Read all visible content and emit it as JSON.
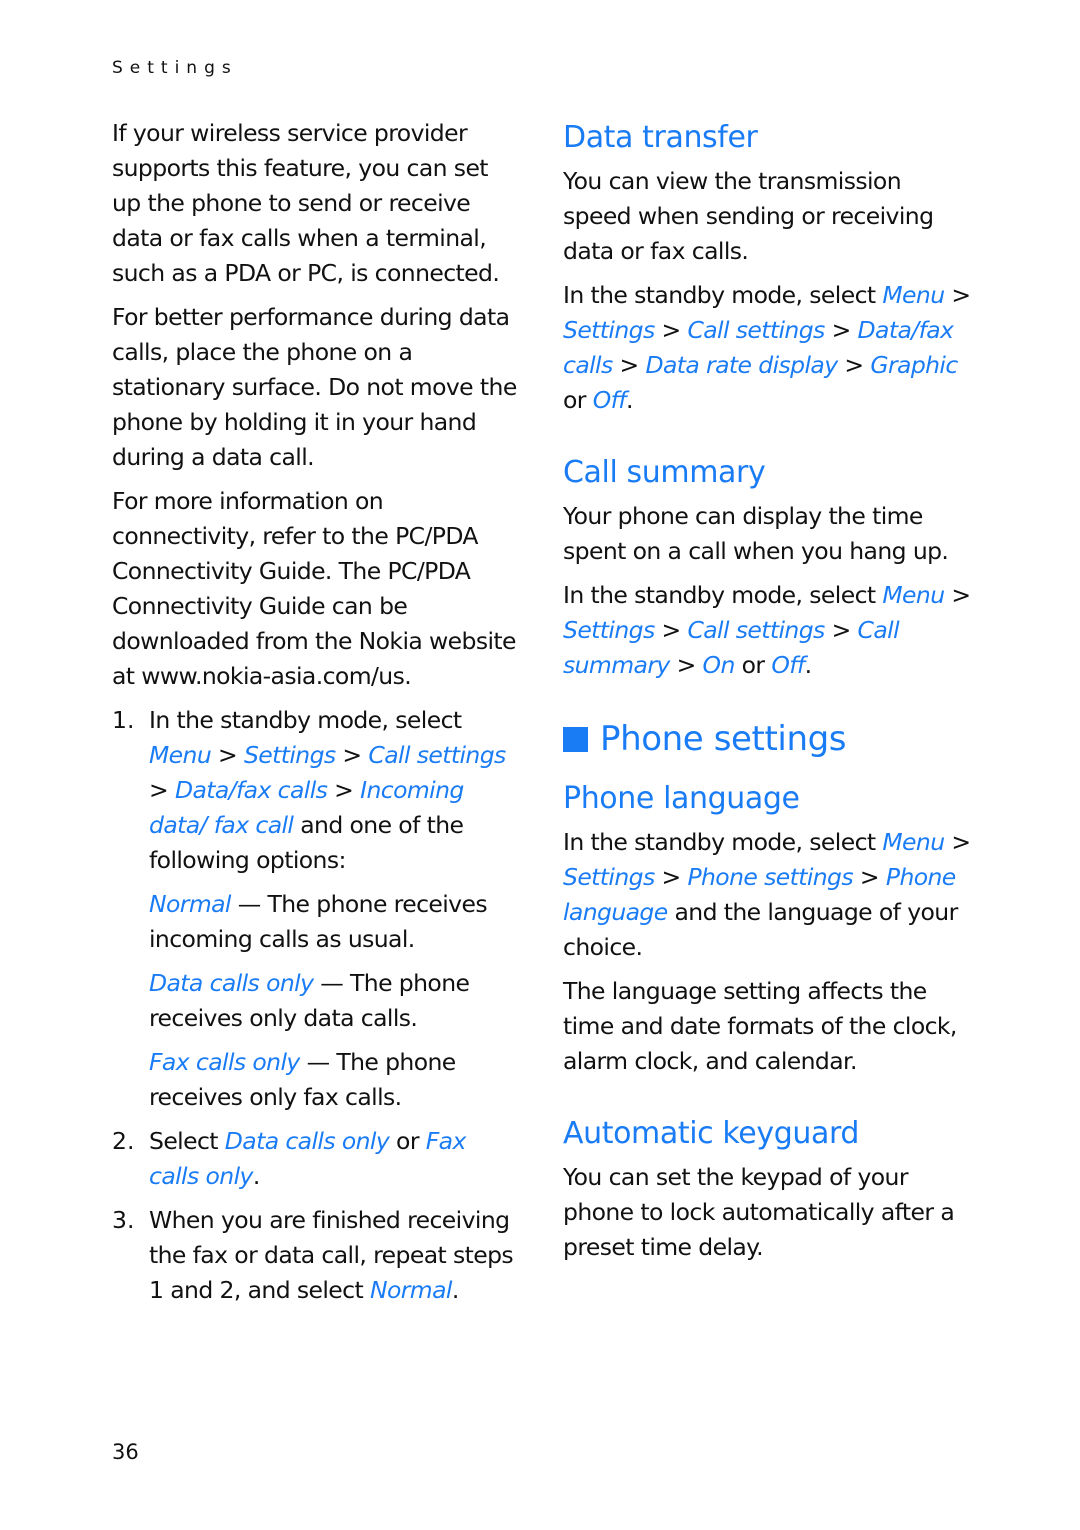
{
  "running_head": "Settings",
  "page_number": "36",
  "accent_color": "#1a7cf5",
  "left": {
    "p1": "If your wireless service provider supports this feature, you can set up the phone to send or receive data or fax calls when a terminal, such as a PDA or PC, is connected.",
    "p2": "For better performance during data calls, place the phone on a stationary surface. Do not move the phone by holding it in your hand during a data call.",
    "p3": "For more information on connectivity, refer to the PC/PDA Connectivity Guide. The PC/PDA Connectivity Guide can be downloaded from the Nokia website at www.nokia-asia.com/us.",
    "steps": [
      {
        "num": "1.",
        "intro": "In the standby mode, select",
        "path": [
          "Menu",
          "Settings",
          "Call settings",
          "Data/fax calls",
          "Incoming data/ fax call"
        ],
        "tail": " and one of the following options:",
        "options": [
          {
            "name": "Normal",
            "desc": " — The phone receives incoming calls as usual."
          },
          {
            "name": "Data calls only",
            "desc": " — The phone receives only data calls."
          },
          {
            "name": "Fax calls only",
            "desc": " — The phone receives only fax calls."
          }
        ]
      },
      {
        "num": "2.",
        "pre": "Select ",
        "opt1": "Data calls only",
        "mid": " or ",
        "opt2": "Fax calls only",
        "end": "."
      },
      {
        "num": "3.",
        "pre": "When you are finished receiving the fax or data call, repeat steps 1 and 2, and select ",
        "opt": "Normal",
        "end": "."
      }
    ]
  },
  "right": {
    "data_transfer": {
      "title": "Data transfer",
      "p1": "You can view the transmission speed when sending or receiving data or fax calls.",
      "intro": "In the standby mode, select ",
      "path": [
        "Menu",
        "Settings",
        "Call settings",
        "Data/fax calls",
        "Data rate display"
      ],
      "opt1": "Graphic",
      "or": " or ",
      "opt2": "Off",
      "end": "."
    },
    "call_summary": {
      "title": "Call summary",
      "p1": "Your phone can display the time spent on a call when you hang up.",
      "intro": "In the standby mode, select ",
      "path": [
        "Menu",
        "Settings",
        "Call settings",
        "Call summary"
      ],
      "opt1": "On",
      "or": " or ",
      "opt2": "Off",
      "end": "."
    },
    "phone_settings": {
      "title": "Phone settings"
    },
    "phone_language": {
      "title": "Phone language",
      "intro": "In the standby mode, select ",
      "path": [
        "Menu",
        "Settings",
        "Phone settings",
        "Phone language"
      ],
      "tail": " and the language of your choice.",
      "p2": "The language setting affects the time and date formats of the clock, alarm clock, and calendar."
    },
    "automatic_keyguard": {
      "title": "Automatic keyguard",
      "p1": "You can set the keypad of your phone to lock automatically after a preset time delay."
    },
    "separator": " > "
  }
}
